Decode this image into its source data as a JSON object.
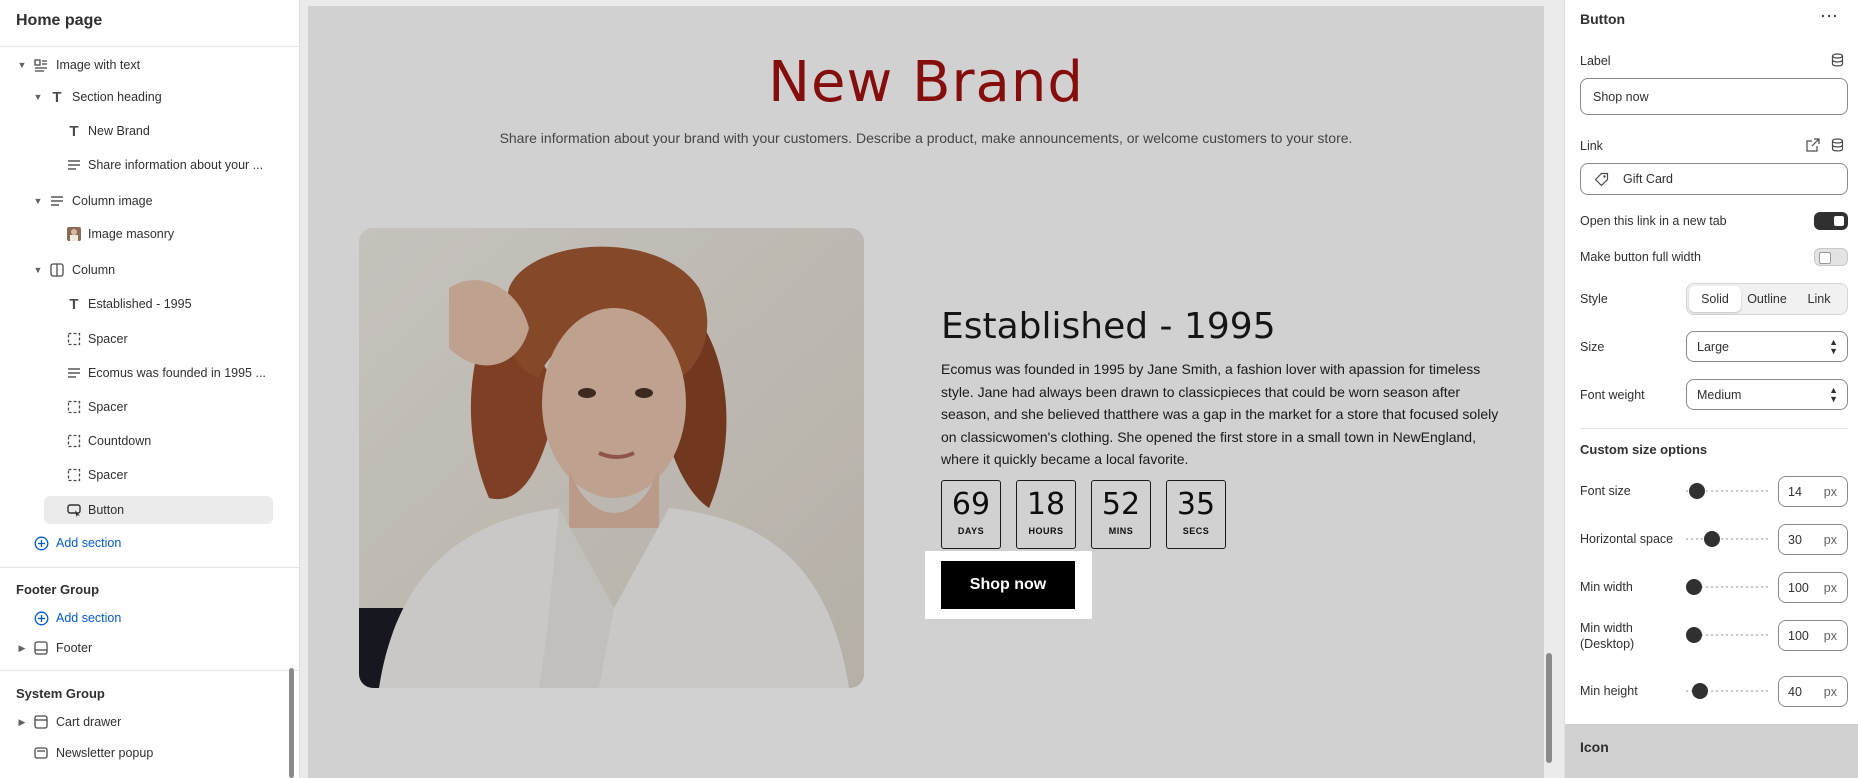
{
  "left": {
    "title": "Home page",
    "tree": [
      {
        "label": "Image with text",
        "icon": "image-text-icon"
      },
      {
        "label": "Section heading",
        "icon": "text-icon"
      },
      {
        "label": "New Brand",
        "icon": "text-icon"
      },
      {
        "label": "Share information about your ...",
        "icon": "paragraph-icon"
      },
      {
        "label": "Column image",
        "icon": "paragraph-icon"
      },
      {
        "label": "Image masonry",
        "icon": "image-thumb-icon"
      },
      {
        "label": "Column",
        "icon": "column-icon"
      },
      {
        "label": "Established - 1995",
        "icon": "text-icon"
      },
      {
        "label": "Spacer",
        "icon": "spacer-icon"
      },
      {
        "label": "Ecomus was founded in 1995 ...",
        "icon": "paragraph-icon"
      },
      {
        "label": "Spacer",
        "icon": "spacer-icon"
      },
      {
        "label": "Countdown",
        "icon": "spacer-icon"
      },
      {
        "label": "Spacer",
        "icon": "spacer-icon"
      },
      {
        "label": "Button",
        "icon": "button-icon"
      }
    ],
    "add_section": "Add section",
    "footer_group": "Footer Group",
    "footer_add_section": "Add section",
    "footer": "Footer",
    "system_group": "System Group",
    "cart_drawer": "Cart drawer",
    "newsletter_popup": "Newsletter popup"
  },
  "preview": {
    "brand": "New Brand",
    "brand_desc": "Share information about your brand with your customers. Describe a product, make announcements, or welcome customers to your store.",
    "heading": "Established - 1995",
    "story": "Ecomus was founded in 1995 by Jane Smith, a fashion lover with apassion for timeless style. Jane had always been drawn to classicpieces that could be worn season after season, and she believed thatthere was a gap in the market for a store that focused solely on classicwomen's clothing. She opened the first store in a small town in NewEngland, where it quickly became a local favorite.",
    "countdown": [
      {
        "num": "69",
        "unit": "DAYS"
      },
      {
        "num": "18",
        "unit": "HOURS"
      },
      {
        "num": "52",
        "unit": "MINS"
      },
      {
        "num": "35",
        "unit": "SECS"
      }
    ],
    "button": "Shop now",
    "brand_color": "#a3110f"
  },
  "panel": {
    "title": "Button",
    "label_field": "Label",
    "label_value": "Shop now",
    "link_field": "Link",
    "link_value": "Gift Card",
    "new_tab": "Open this link in a new tab",
    "new_tab_on": true,
    "full_width": "Make button full width",
    "full_width_on": false,
    "style_label": "Style",
    "style_options": [
      "Solid",
      "Outline",
      "Link"
    ],
    "style_selected": "Solid",
    "size_label": "Size",
    "size_value": "Large",
    "font_weight_label": "Font weight",
    "font_weight_value": "Medium",
    "custom_size": "Custom size options",
    "font_size_label": "Font size",
    "font_size": "14",
    "hspace_label": "Horizontal space",
    "hspace": "30",
    "min_width_label": "Min width",
    "min_width": "100",
    "min_width_desktop_label": "Min width (Desktop)",
    "min_width_desktop": "100",
    "min_height_label": "Min height",
    "min_height": "40",
    "unit": "px",
    "icon_heading": "Icon"
  }
}
